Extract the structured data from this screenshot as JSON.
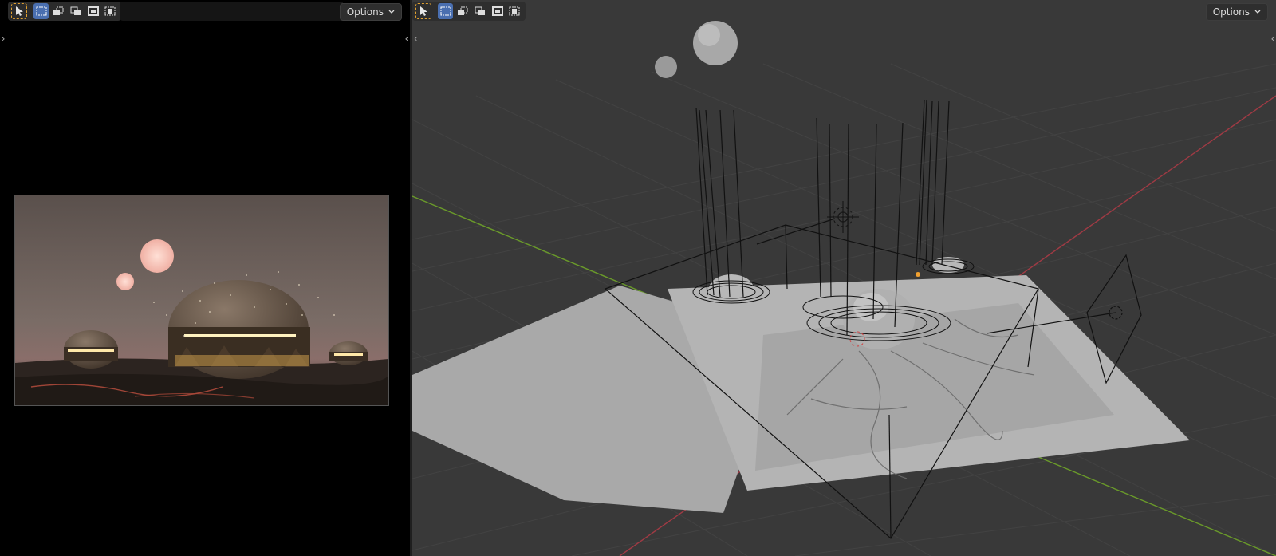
{
  "left_editor": {
    "header": {
      "options_label": "Options"
    }
  },
  "right_editor": {
    "header": {
      "options_label": "Options"
    }
  },
  "colors": {
    "active_mode": "#4a6fb0",
    "select_tool_outline": "#e0a030",
    "viewport_background": "#393939",
    "axis_x": "#c0404a",
    "axis_y": "#6a9a2a"
  },
  "icons": {
    "select": "cursor-arrow-icon",
    "mode_new": "select-new-icon",
    "mode_extend": "select-extend-icon",
    "mode_subtract": "select-subtract-icon",
    "mode_invert": "select-invert-icon",
    "mode_intersect": "select-intersect-icon",
    "dropdown": "chevron-down-icon"
  }
}
